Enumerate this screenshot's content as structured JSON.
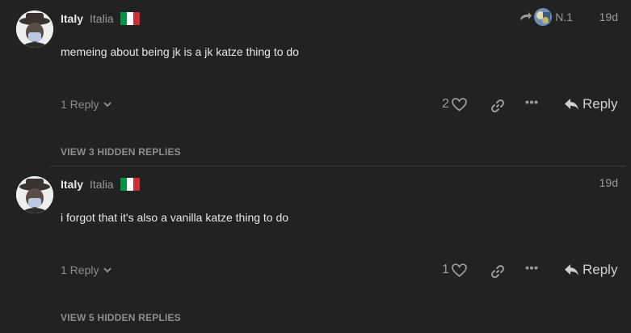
{
  "posts": [
    {
      "username": "Italy",
      "fullname": "Italia",
      "date": "19d",
      "reply_to_name": "N.1",
      "body": "memeing about being jk is a jk katze thing to do",
      "replies_label": "1 Reply",
      "like_count": "2",
      "reply_label": "Reply",
      "hidden_replies": "VIEW 3 HIDDEN REPLIES"
    },
    {
      "username": "Italy",
      "fullname": "Italia",
      "date": "19d",
      "body": "i forgot that it's also a vanilla katze thing to do",
      "replies_label": "1 Reply",
      "like_count": "1",
      "reply_label": "Reply",
      "hidden_replies": "VIEW 5 HIDDEN REPLIES"
    }
  ],
  "icons": {
    "flag": "italy-flag-icon",
    "share": "reply-arrow-icon",
    "like": "heart-icon",
    "link": "link-icon",
    "more": "more-options-icon",
    "reply": "reply-icon",
    "chevron": "chevron-down-icon"
  },
  "colors": {
    "background": "#222222",
    "text": "#e6e6e6",
    "muted": "#9a9a9a",
    "flag_green": "#009246",
    "flag_white": "#ffffff",
    "flag_red": "#ce2b37"
  }
}
